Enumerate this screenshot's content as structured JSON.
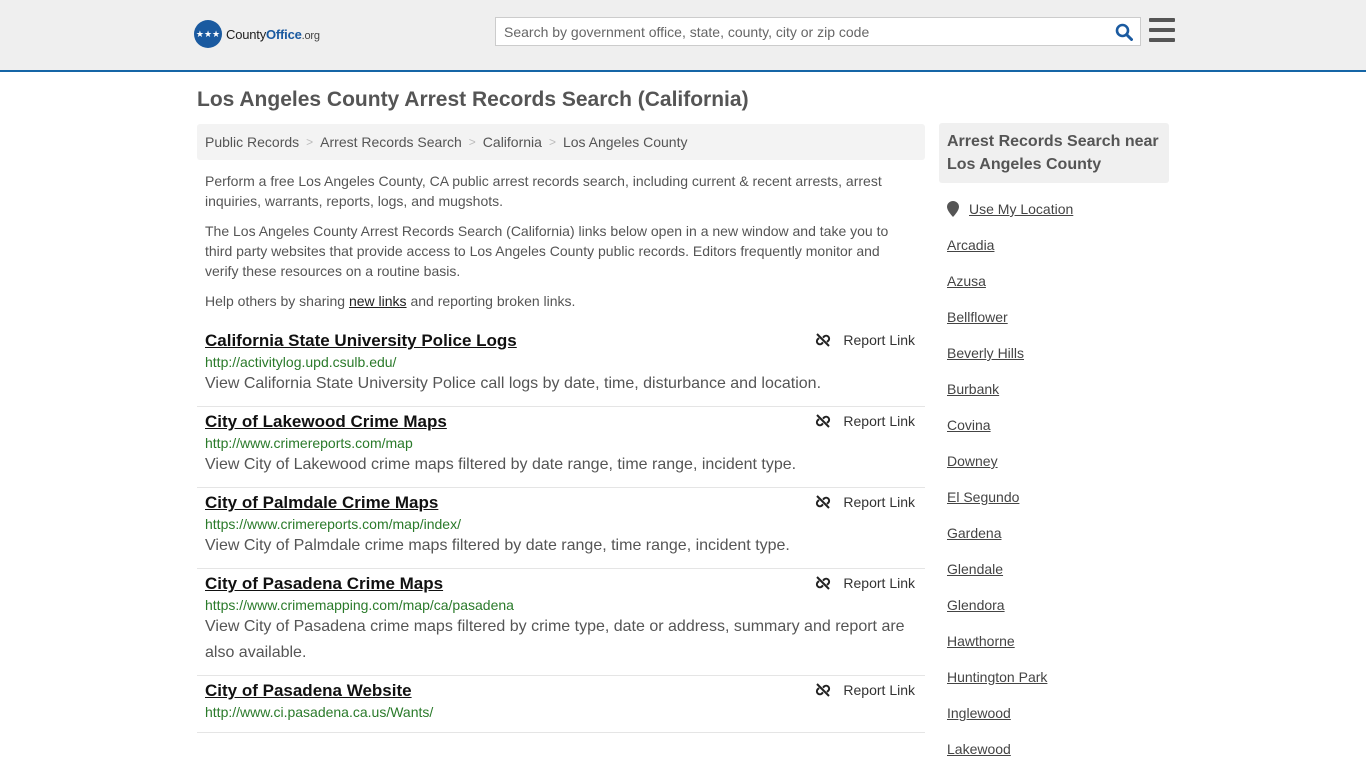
{
  "header": {
    "logo": {
      "part1": "County",
      "part2": "Office",
      "part3": ".org"
    },
    "search_placeholder": "Search by government office, state, county, city or zip code",
    "colors": {
      "brand": "#1a5aa0",
      "accent_border": "#1565a6"
    }
  },
  "page": {
    "title": "Los Angeles County Arrest Records Search (California)",
    "breadcrumb": [
      "Public Records",
      "Arrest Records Search",
      "California",
      "Los Angeles County"
    ],
    "intro": {
      "p1": "Perform a free Los Angeles County, CA public arrest records search, including current & recent arrests, arrest inquiries, warrants, reports, logs, and mugshots.",
      "p2": "The Los Angeles County Arrest Records Search (California) links below open in a new window and take you to third party websites that provide access to Los Angeles County public records. Editors frequently monitor and verify these resources on a routine basis.",
      "p3_before": "Help others by sharing ",
      "p3_link": "new links",
      "p3_after": " and reporting broken links."
    }
  },
  "listings": [
    {
      "title": "California State University Police Logs",
      "url": "http://activitylog.upd.csulb.edu/",
      "description": "View California State University Police call logs by date, time, disturbance and location.",
      "report_label": "Report Link"
    },
    {
      "title": "City of Lakewood Crime Maps",
      "url": "http://www.crimereports.com/map",
      "description": "View City of Lakewood crime maps filtered by date range, time range, incident type.",
      "report_label": "Report Link"
    },
    {
      "title": "City of Palmdale Crime Maps",
      "url": "https://www.crimereports.com/map/index/",
      "description": "View City of Palmdale crime maps filtered by date range, time range, incident type.",
      "report_label": "Report Link"
    },
    {
      "title": "City of Pasadena Crime Maps",
      "url": "https://www.crimemapping.com/map/ca/pasadena",
      "description": "View City of Pasadena crime maps filtered by crime type, date or address, summary and report are also available.",
      "report_label": "Report Link"
    },
    {
      "title": "City of Pasadena Website",
      "url": "http://www.ci.pasadena.ca.us/Wants/",
      "description": "",
      "report_label": "Report Link"
    }
  ],
  "sidebar": {
    "heading": "Arrest Records Search near Los Angeles County",
    "use_location": "Use My Location",
    "cities": [
      "Arcadia",
      "Azusa",
      "Bellflower",
      "Beverly Hills",
      "Burbank",
      "Covina",
      "Downey",
      "El Segundo",
      "Gardena",
      "Glendale",
      "Glendora",
      "Hawthorne",
      "Huntington Park",
      "Inglewood",
      "Lakewood"
    ]
  }
}
